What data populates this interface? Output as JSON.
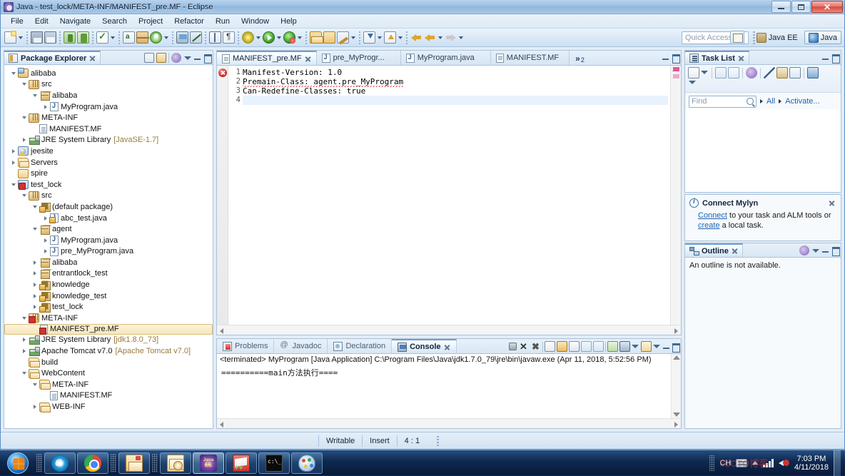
{
  "window": {
    "title": "Java - test_lock/META-INF/MANIFEST_pre.MF - Eclipse",
    "minimize_label": "Minimize",
    "restore_label": "Restore",
    "close_label": "Close"
  },
  "menubar": {
    "items": [
      {
        "label": "File"
      },
      {
        "label": "Edit"
      },
      {
        "label": "Navigate"
      },
      {
        "label": "Search"
      },
      {
        "label": "Project"
      },
      {
        "label": "Refactor"
      },
      {
        "label": "Run"
      },
      {
        "label": "Window"
      },
      {
        "label": "Help"
      }
    ]
  },
  "toolbar": {
    "quick_access_placeholder": "Quick Access",
    "perspectives": [
      {
        "label": "Java EE",
        "active": false
      },
      {
        "label": "Java",
        "active": true
      }
    ],
    "icons": [
      "new-wizard-icon",
      "save-icon",
      "save-all-icon",
      "android-sdk-manager-icon",
      "android-avd-manager-icon",
      "build-icon",
      "new-java-class-icon",
      "new-java-package-icon",
      "refresh-icon",
      "open-monitor-icon",
      "skip-breakpoints-icon",
      "open-type-icon",
      "format-paragraph-icon",
      "debug-icon",
      "run-icon",
      "run-last-tool-icon",
      "open-external-file-icon",
      "open-folder-icon",
      "brush-icon",
      "import-icon",
      "export-icon",
      "back-icon",
      "forward-icon"
    ]
  },
  "package_explorer": {
    "title": "Package Explorer",
    "toolbar_icons": [
      "collapse-all-icon",
      "link-with-editor-icon",
      "focus-on-active-task-icon",
      "view-menu-icon",
      "minimize-icon",
      "maximize-icon"
    ],
    "tree": [
      {
        "label": "alibaba",
        "indent": 0,
        "twist": "open",
        "icon": "project",
        "sub": ""
      },
      {
        "label": "src",
        "indent": 1,
        "twist": "open",
        "icon": "srcfolder",
        "sub": ""
      },
      {
        "label": "alibaba",
        "indent": 2,
        "twist": "open",
        "icon": "package",
        "sub": ""
      },
      {
        "label": "MyProgram.java",
        "indent": 3,
        "twist": "closed",
        "icon": "javafile",
        "sub": ""
      },
      {
        "label": "META-INF",
        "indent": 1,
        "twist": "open",
        "icon": "srcfolder",
        "sub": ""
      },
      {
        "label": "MANIFEST.MF",
        "indent": 2,
        "twist": "none",
        "icon": "mf",
        "sub": ""
      },
      {
        "label": "JRE System Library",
        "indent": 1,
        "twist": "closed",
        "icon": "lib",
        "sub": "[JavaSE-1.7]"
      },
      {
        "label": "jeesite",
        "indent": 0,
        "twist": "closed",
        "icon": "jproject-warn",
        "sub": ""
      },
      {
        "label": "Servers",
        "indent": 0,
        "twist": "closed",
        "icon": "folder",
        "sub": ""
      },
      {
        "label": "spire",
        "indent": 0,
        "twist": "none",
        "icon": "folderplain",
        "sub": ""
      },
      {
        "label": "test_lock",
        "indent": 0,
        "twist": "open",
        "icon": "jproject-err",
        "sub": ""
      },
      {
        "label": "src",
        "indent": 1,
        "twist": "open",
        "icon": "srcfolder",
        "sub": ""
      },
      {
        "label": "(default package)",
        "indent": 2,
        "twist": "open",
        "icon": "packagelock",
        "sub": ""
      },
      {
        "label": "abc_test.java",
        "indent": 3,
        "twist": "closed",
        "icon": "javafile-lock",
        "sub": ""
      },
      {
        "label": "agent",
        "indent": 2,
        "twist": "open",
        "icon": "package",
        "sub": ""
      },
      {
        "label": "MyProgram.java",
        "indent": 3,
        "twist": "closed",
        "icon": "javafile",
        "sub": ""
      },
      {
        "label": "pre_MyProgram.java",
        "indent": 3,
        "twist": "closed",
        "icon": "javafile",
        "sub": ""
      },
      {
        "label": "alibaba",
        "indent": 2,
        "twist": "closed",
        "icon": "package",
        "sub": ""
      },
      {
        "label": "entrantlock_test",
        "indent": 2,
        "twist": "closed",
        "icon": "package",
        "sub": ""
      },
      {
        "label": "knowledge",
        "indent": 2,
        "twist": "closed",
        "icon": "packagelock",
        "sub": ""
      },
      {
        "label": "knowledge_test",
        "indent": 2,
        "twist": "closed",
        "icon": "packagelock",
        "sub": ""
      },
      {
        "label": "test_lock",
        "indent": 2,
        "twist": "closed",
        "icon": "packagelock",
        "sub": ""
      },
      {
        "label": "META-INF",
        "indent": 1,
        "twist": "open",
        "icon": "srcfolder-err",
        "sub": ""
      },
      {
        "label": "MANIFEST_pre.MF",
        "indent": 2,
        "twist": "none",
        "icon": "mf-err",
        "sub": "",
        "selected": true
      },
      {
        "label": "JRE System Library",
        "indent": 1,
        "twist": "closed",
        "icon": "lib",
        "sub": "[jdk1.8.0_73]"
      },
      {
        "label": "Apache Tomcat v7.0",
        "indent": 1,
        "twist": "closed",
        "icon": "lib",
        "sub": "[Apache Tomcat v7.0]"
      },
      {
        "label": "build",
        "indent": 1,
        "twist": "none",
        "icon": "folder",
        "sub": ""
      },
      {
        "label": "WebContent",
        "indent": 1,
        "twist": "open",
        "icon": "folder",
        "sub": ""
      },
      {
        "label": "META-INF",
        "indent": 2,
        "twist": "open",
        "icon": "folder",
        "sub": ""
      },
      {
        "label": "MANIFEST.MF",
        "indent": 3,
        "twist": "none",
        "icon": "mf",
        "sub": ""
      },
      {
        "label": "WEB-INF",
        "indent": 2,
        "twist": "closed",
        "icon": "folder",
        "sub": ""
      }
    ]
  },
  "editor": {
    "tabs": [
      {
        "label": "MANIFEST_pre.MF",
        "icon": "manifest-file-icon",
        "active": true,
        "closable": true
      },
      {
        "label": "pre_MyProgr...",
        "icon": "java-file-icon",
        "active": false,
        "closable": false
      },
      {
        "label": "MyProgram.java",
        "icon": "java-file-icon",
        "active": false,
        "closable": false
      },
      {
        "label": "MANIFEST.MF",
        "icon": "manifest-file-icon",
        "active": false,
        "closable": false
      }
    ],
    "overflow_chevron": "»",
    "overflow_count": "2",
    "minimize_label": "Minimize",
    "maximize_label": "Maximize",
    "has_error_marker": true,
    "lines": [
      {
        "num": "1",
        "text": "Manifest-Version: 1.0",
        "error": false,
        "current": false
      },
      {
        "num": "2",
        "text": "Premain-Class: agent.pre_MyProgram",
        "error": true,
        "current": false
      },
      {
        "num": "3",
        "text": "Can-Redefine-Classes: true",
        "error": false,
        "current": false
      },
      {
        "num": "4",
        "text": "",
        "error": false,
        "current": true
      }
    ]
  },
  "console_panel": {
    "tabs": [
      {
        "label": "Problems",
        "icon": "problems-icon",
        "active": false
      },
      {
        "label": "Javadoc",
        "icon": "javadoc-icon",
        "active": false
      },
      {
        "label": "Declaration",
        "icon": "declaration-icon",
        "active": false
      },
      {
        "label": "Console",
        "icon": "console-icon",
        "active": true
      }
    ],
    "toolbar_icons": [
      "terminate-icon",
      "remove-launch-icon",
      "remove-all-terminated-icon",
      "clear-console-icon",
      "scroll-lock-icon",
      "word-wrap-icon",
      "show-console-on-output-icon",
      "pin-console-icon",
      "display-selected-console-icon",
      "open-console-icon",
      "open-console-menu-icon",
      "minimize-icon",
      "maximize-icon"
    ],
    "header": "<terminated> MyProgram [Java Application] C:\\Program Files\\Java\\jdk1.7.0_79\\jre\\bin\\javaw.exe (Apr 11, 2018, 5:52:56 PM)",
    "output": "==========main方法执行===="
  },
  "task_list": {
    "title": "Task List",
    "toolbar_icons": [
      "new-task-icon",
      "new-task-dropdown-icon",
      "categorized-presentation-icon",
      "scheduled-presentation-icon",
      "focus-on-workweek-icon",
      "synchronize-changed-icon",
      "collapse-all-icon",
      "restore-tasks-icon",
      "view-menu-icon"
    ],
    "find_placeholder": "Find",
    "filter_all": "All",
    "filter_activate": "Activate...",
    "minimize_label": "Minimize",
    "maximize_label": "Maximize"
  },
  "mylyn": {
    "title": "Connect Mylyn",
    "link_connect": "Connect",
    "text_middle": " to your task and ALM tools or ",
    "link_create": "create",
    "text_end": " a local task.",
    "close_label": "Close"
  },
  "outline": {
    "title": "Outline",
    "message": "An outline is not available.",
    "toolbar_icons": [
      "focus-on-active-task-icon",
      "view-menu-icon",
      "minimize-icon",
      "maximize-icon"
    ]
  },
  "statusbar": {
    "writable": "Writable",
    "insert": "Insert",
    "position": "4 : 1"
  },
  "taskbar": {
    "start_label": "Start",
    "apps": [
      {
        "name": "internet-explorer",
        "icon": "ie-icon",
        "active": false
      },
      {
        "name": "google-chrome",
        "icon": "chrome-icon",
        "active": false
      },
      {
        "name": "windows-explorer",
        "icon": "explorer-icon",
        "active": false
      },
      {
        "name": "outlook",
        "icon": "outlook-icon",
        "active": false
      },
      {
        "name": "eclipse-java-ee",
        "icon": "eclipse-icon",
        "active": true
      },
      {
        "name": "notepad-plus-plus",
        "icon": "notepadpp-icon",
        "active": false
      },
      {
        "name": "command-prompt",
        "icon": "cmd-icon",
        "active": false
      },
      {
        "name": "paint",
        "icon": "paint-icon",
        "active": false
      }
    ],
    "tray": {
      "ime": "CH",
      "time": "7:03 PM",
      "date": "4/11/2018"
    },
    "watermark": "51CTO博客"
  }
}
